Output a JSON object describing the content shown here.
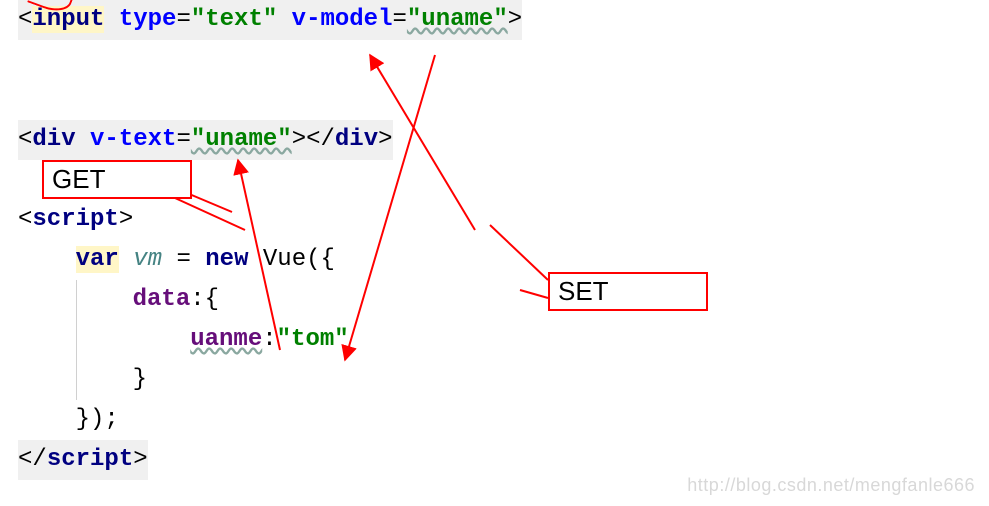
{
  "callouts": {
    "get": "GET",
    "set": "SET"
  },
  "watermark": "http://blog.csdn.net/mengfanle666",
  "code": {
    "l1": {
      "lt": "<",
      "tag": "input",
      "sp": " ",
      "a1": "type",
      "eq": "=",
      "v1": "\"text\"",
      "a2": "v-model",
      "v2": "\"uname\"",
      "gt": ">"
    },
    "l2": {
      "lt": "<",
      "tag": "div",
      "sp": " ",
      "a1": "v-text",
      "eq": "=",
      "v1": "\"uname\"",
      "gt": ">",
      "lt2": "</",
      "tag2": "div",
      "gt2": ">"
    },
    "l3": {
      "lt": "<",
      "tag": "script",
      "gt": ">"
    },
    "l4": {
      "kw": "var",
      "sp": " ",
      "vm": "vm",
      "eq": " = ",
      "new": "new",
      "vue": " Vue({"
    },
    "l5": {
      "prop": "data",
      "colon": ":",
      "brace": "{"
    },
    "l6": {
      "prop": "uanme",
      "colon": ":",
      "val": "\"tom\""
    },
    "l7": {
      "brace": "}"
    },
    "l8": {
      "close": "});"
    },
    "l9": {
      "lt": "</",
      "tag": "script",
      "gt": ">"
    }
  }
}
